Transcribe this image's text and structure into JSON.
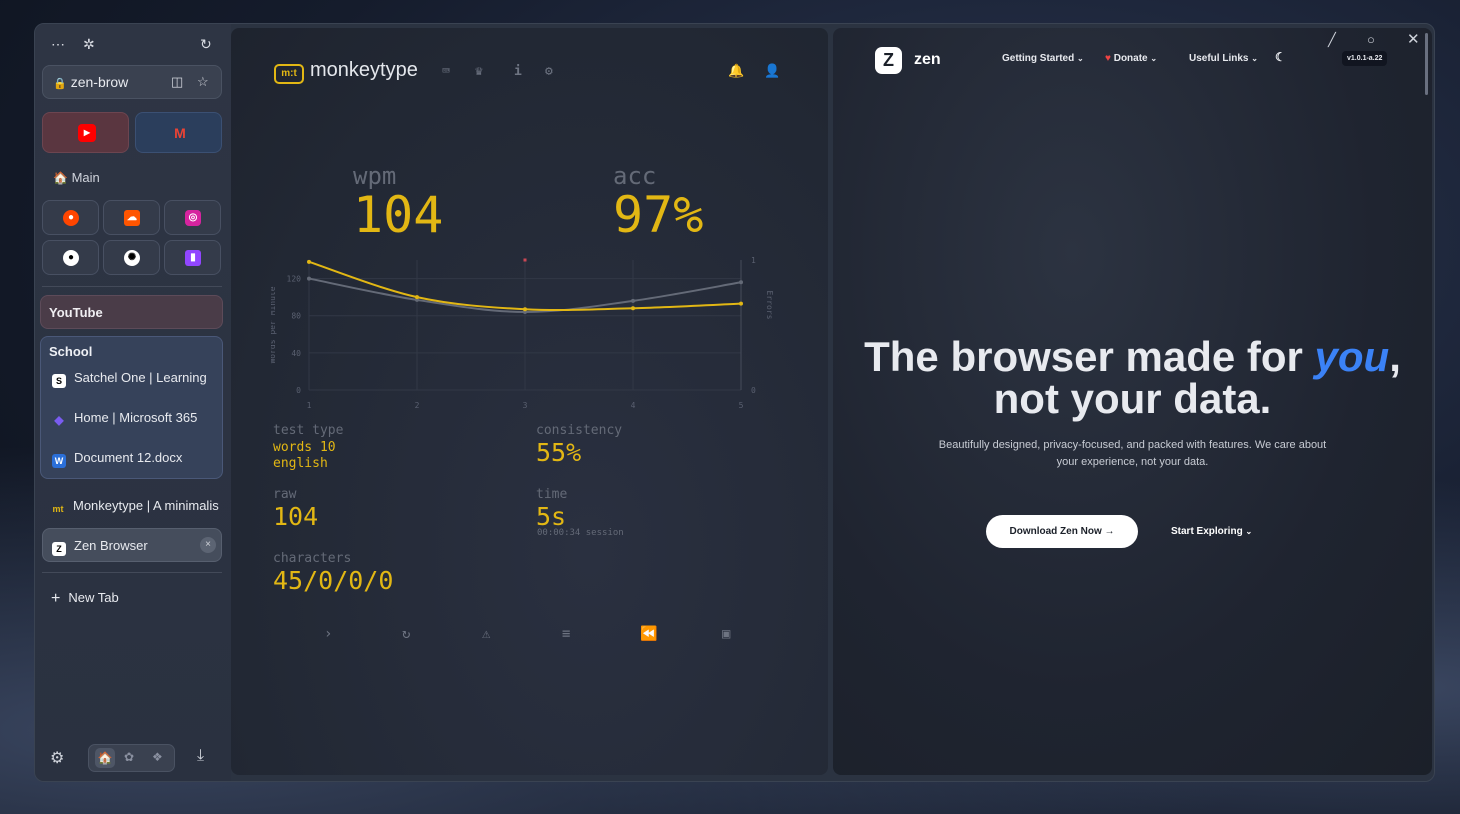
{
  "sidebar": {
    "url_text": "zen-brow",
    "workspace_label": "Main",
    "pinned_youtube_group": "YouTube",
    "school_group": {
      "title": "School",
      "tabs": [
        {
          "label": "Satchel One | Learning",
          "icon": "satchel-one-icon",
          "glyph": "S",
          "color": "#ffffff"
        },
        {
          "label": "Home | Microsoft 365",
          "icon": "microsoft-365-icon",
          "glyph": "◆",
          "color": "#7a5cf0"
        },
        {
          "label": "Document 12.docx",
          "icon": "word-document-icon",
          "glyph": "W",
          "color": "#2b6fd8"
        }
      ]
    },
    "tabs": [
      {
        "label": "Monkeytype | A minimalistic",
        "icon": "monkeytype-icon",
        "glyph": "mt"
      },
      {
        "label": "Zen Browser",
        "icon": "zen-icon",
        "glyph": "Z"
      }
    ],
    "new_tab_label": "New Tab"
  },
  "monkeytype": {
    "logo_text": "monkeytype",
    "wpm_label": "wpm",
    "wpm_value": "104",
    "acc_label": "acc",
    "acc_value": "97%",
    "test_type_label": "test type",
    "test_type_value_1": "words 10",
    "test_type_value_2": "english",
    "consistency_label": "consistency",
    "consistency_value": "55%",
    "raw_label": "raw",
    "raw_value": "104",
    "time_label": "time",
    "time_value": "5s",
    "time_session": "00:00:34 session",
    "characters_label": "characters",
    "characters_value": "45/0/0/0"
  },
  "chart_data": {
    "type": "line",
    "x": [
      1,
      2,
      3,
      4,
      5
    ],
    "series": [
      {
        "values": [
          138,
          100,
          87,
          88,
          93
        ],
        "color": "#e2b714"
      },
      {
        "values": [
          120,
          97,
          84,
          96,
          116
        ],
        "color": "#646a77"
      }
    ],
    "error_points": [
      {
        "x": 3,
        "y": 1
      }
    ],
    "ylabel": "Words per Minute",
    "y2label": "Errors",
    "ylim": [
      0,
      140
    ],
    "y2lim": [
      0,
      1
    ],
    "y_ticks": [
      "0",
      "40",
      "80",
      "120"
    ],
    "y2_ticks": [
      "0",
      "1"
    ],
    "x_ticks": [
      "1",
      "2",
      "3",
      "4",
      "5"
    ],
    "grid": true
  },
  "zen": {
    "brand": "zen",
    "nav": [
      "Getting Started",
      "Donate",
      "Useful Links"
    ],
    "version": "v1.0.1-a.22",
    "headline_1": "The browser made for ",
    "headline_you": "you",
    "headline_comma": ",",
    "headline_2": "not your data.",
    "sub_1": "Beautifully designed, privacy-focused, and packed with features. We care about",
    "sub_2": "your experience, not your data.",
    "download_label": "Download Zen Now",
    "explore_label": "Start Exploring"
  }
}
